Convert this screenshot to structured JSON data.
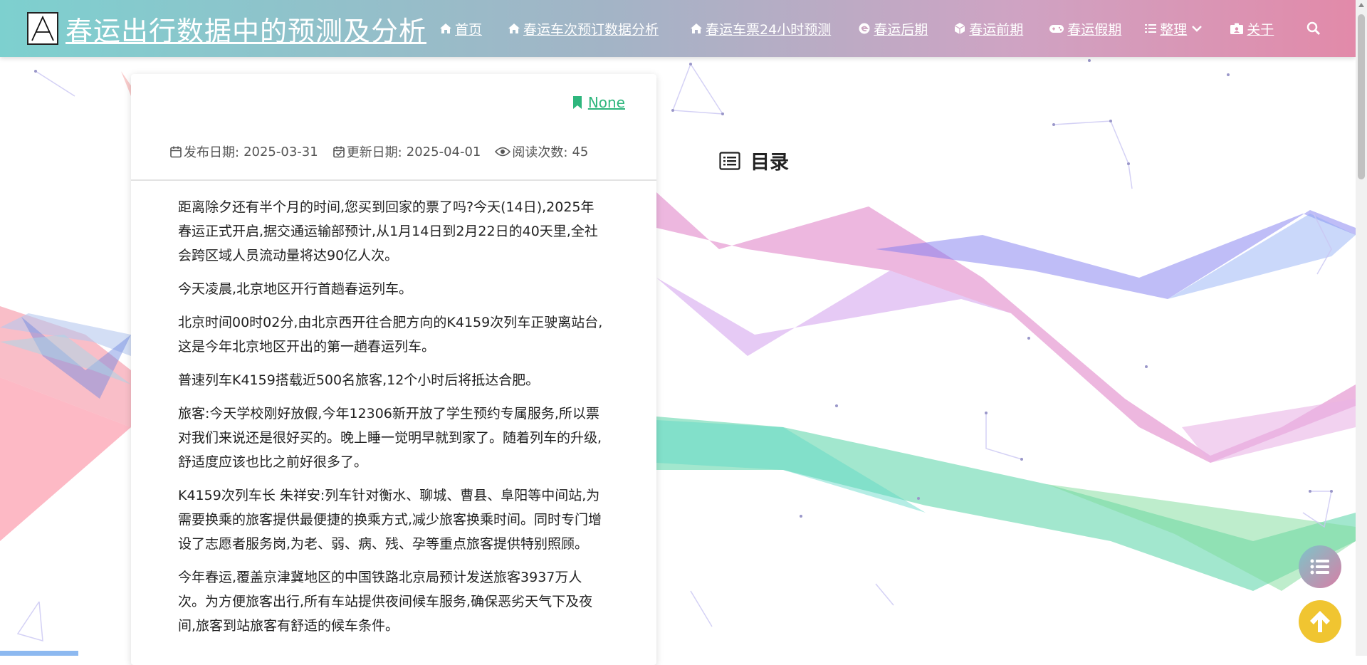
{
  "header": {
    "logo_letter": "A",
    "site_title": "春运出行数据中的预测及分析"
  },
  "nav": {
    "items": [
      {
        "label": "首页",
        "icon": "home-icon"
      },
      {
        "label": "春运车次预订数据分析",
        "icon": "home-icon"
      },
      {
        "label": "春运车票24小时预测",
        "icon": "home-icon"
      },
      {
        "label": "春运后期",
        "icon": "edge-icon"
      },
      {
        "label": "春运前期",
        "icon": "cube-icon"
      },
      {
        "label": "春运假期",
        "icon": "gamepad-icon"
      },
      {
        "label": "整理",
        "icon": "list-icon"
      },
      {
        "label": "关于",
        "icon": "id-card-icon"
      }
    ],
    "search_icon": "search-icon"
  },
  "article": {
    "tag": "None",
    "publish_label": "发布日期:",
    "publish_date": "2025-03-31",
    "update_label": "更新日期:",
    "update_date": "2025-04-01",
    "views_label": "阅读次数:",
    "views": "45",
    "paragraphs": [
      "距离除夕还有半个月的时间,您买到回家的票了吗?今天(14日),2025年春运正式开启,据交通运输部预计,从1月14日到2月22日的40天里,全社会跨区域人员流动量将达90亿人次。",
      "今天凌晨,北京地区开行首趟春运列车。",
      "北京时间00时02分,由北京西开往合肥方向的K4159次列车正驶离站台,这是今年北京地区开出的第一趟春运列车。",
      "普速列车K4159搭载近500名旅客,12个小时后将抵达合肥。",
      "旅客:今天学校刚好放假,今年12306新开放了学生预约专属服务,所以票对我们来说还是很好买的。晚上睡一觉明早就到家了。随着列车的升级,舒适度应该也比之前好很多了。",
      "K4159次列车长 朱祥安:列车针对衡水、聊城、曹县、阜阳等中间站,为需要换乘的旅客提供最便捷的换乘方式,减少旅客换乘时间。同时专门增设了志愿者服务岗,为老、弱、病、残、孕等重点旅客提供特别照顾。",
      "今年春运,覆盖京津冀地区的中国铁路北京局预计发送旅客3937万人次。为方便旅客出行,所有车站提供夜间候车服务,确保恶劣天气下及夜间,旅客到站旅客有舒适的候车条件。"
    ]
  },
  "toc": {
    "title": "目录"
  },
  "colors": {
    "tag_green": "#2eb67d",
    "fab_top": "#f0c531"
  }
}
